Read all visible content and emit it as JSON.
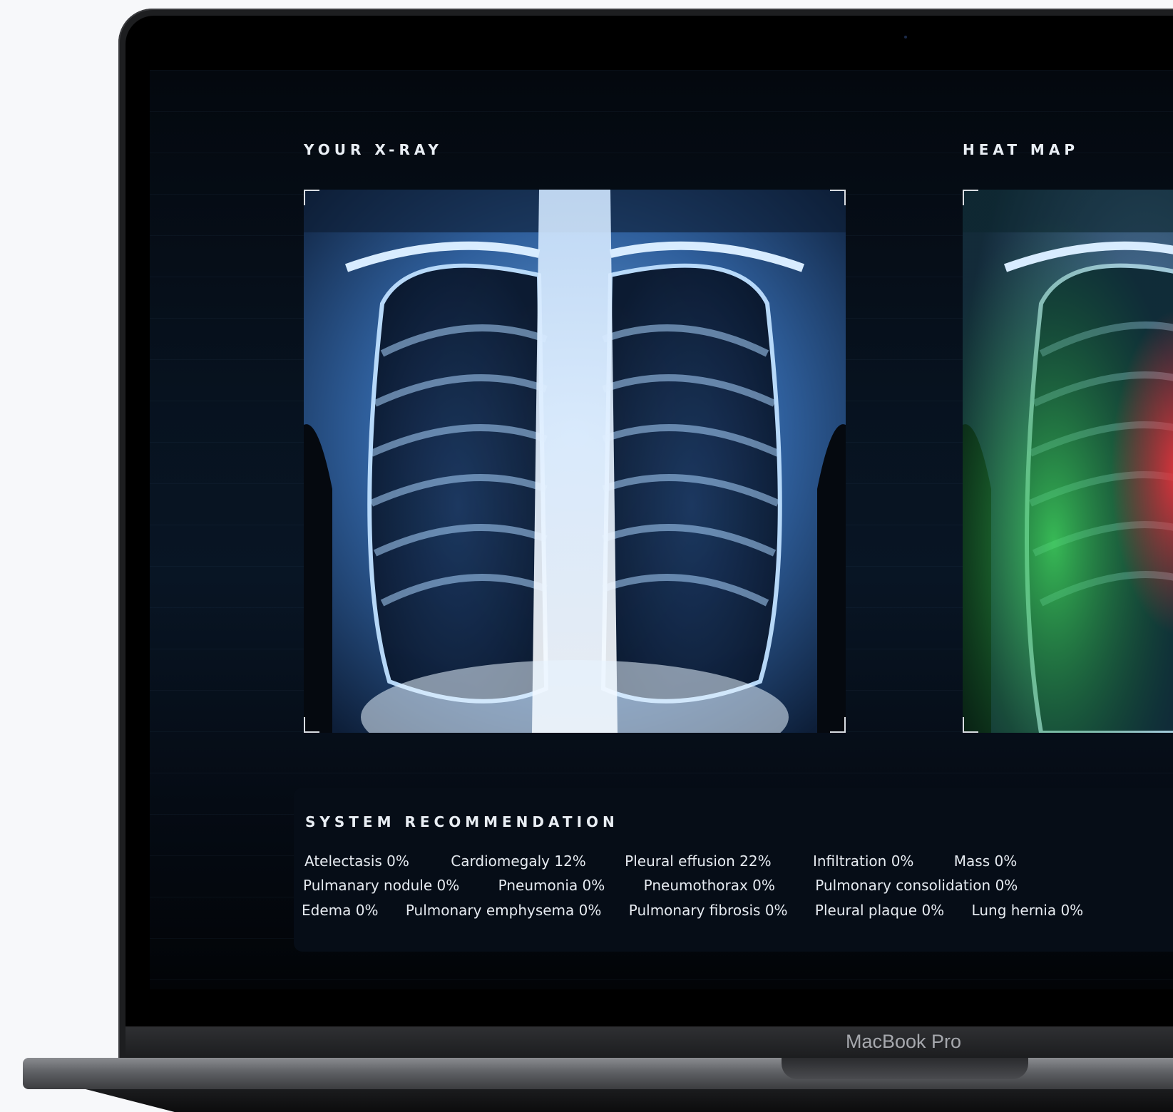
{
  "device": {
    "brand_label": "MacBook Pro"
  },
  "xray_panel": {
    "title": "YOUR X-RAY"
  },
  "heatmap_panel": {
    "title": "HEAT MAP"
  },
  "recommendation": {
    "title": "SYSTEM RECOMMENDATION",
    "rows": [
      [
        "Atelectasis 0%",
        "Cardiomegaly 12%",
        "Pleural effusion 22%",
        "Infiltration 0%",
        "Mass 0%"
      ],
      [
        "Pulmanary nodule 0%",
        "Pneumonia 0%",
        "Pneumothorax 0%",
        "Pulmonary consolidation 0%"
      ],
      [
        "Edema 0%",
        "Pulmonary emphysema 0%",
        "Pulmonary fibrosis 0%",
        "Pleural plaque 0%",
        "Lung hernia 0%"
      ]
    ]
  }
}
